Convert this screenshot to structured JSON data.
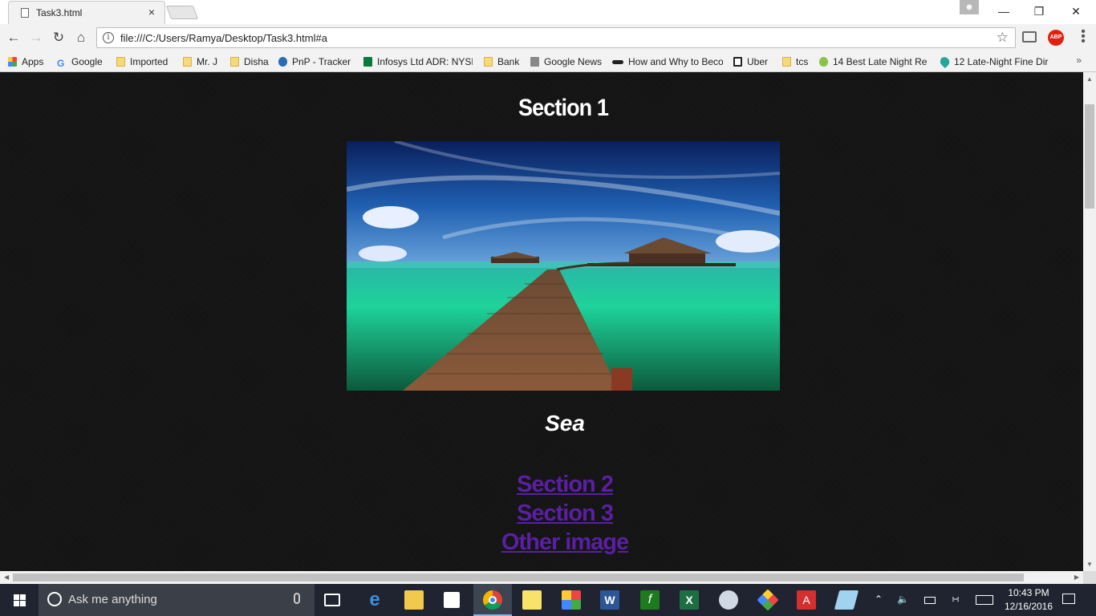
{
  "browser": {
    "tab_title": "Task3.html",
    "tab_close": "×",
    "url": "file:///C:/Users/Ramya/Desktop/Task3.html#a",
    "bookmarks": [
      {
        "label": "Apps",
        "icon": "apps-grid-icon"
      },
      {
        "label": "Google",
        "icon": "google-icon"
      },
      {
        "label": "Imported",
        "icon": "folder-icon"
      },
      {
        "label": "Mr. J",
        "icon": "folder-icon"
      },
      {
        "label": "Disha",
        "icon": "folder-icon"
      },
      {
        "label": "PnP - Tracker",
        "icon": "tata-icon"
      },
      {
        "label": "Infosys Ltd ADR: NYSE",
        "icon": "infosys-icon"
      },
      {
        "label": "Bank",
        "icon": "folder-icon"
      },
      {
        "label": "Google News",
        "icon": "news-icon"
      },
      {
        "label": "How and Why to Beco",
        "icon": "mustache-icon"
      },
      {
        "label": "Uber",
        "icon": "uber-icon"
      },
      {
        "label": "tcs",
        "icon": "folder-icon"
      },
      {
        "label": "14 Best Late Night Re",
        "icon": "pear-icon"
      },
      {
        "label": "12 Late-Night Fine Dir",
        "icon": "map-pin-icon"
      }
    ],
    "more_label": "»",
    "abp_label": "ABP"
  },
  "page": {
    "title": "Section 1",
    "caption": "Sea",
    "links": [
      "Section 2",
      "Section 3",
      "Other image"
    ]
  },
  "taskbar": {
    "search_placeholder": "Ask me anything",
    "time": "10:43 PM",
    "date": "12/16/2016"
  },
  "colors": {
    "page_background": "#121212",
    "link": "#5a1fa3",
    "taskbar": "#1f2430"
  }
}
